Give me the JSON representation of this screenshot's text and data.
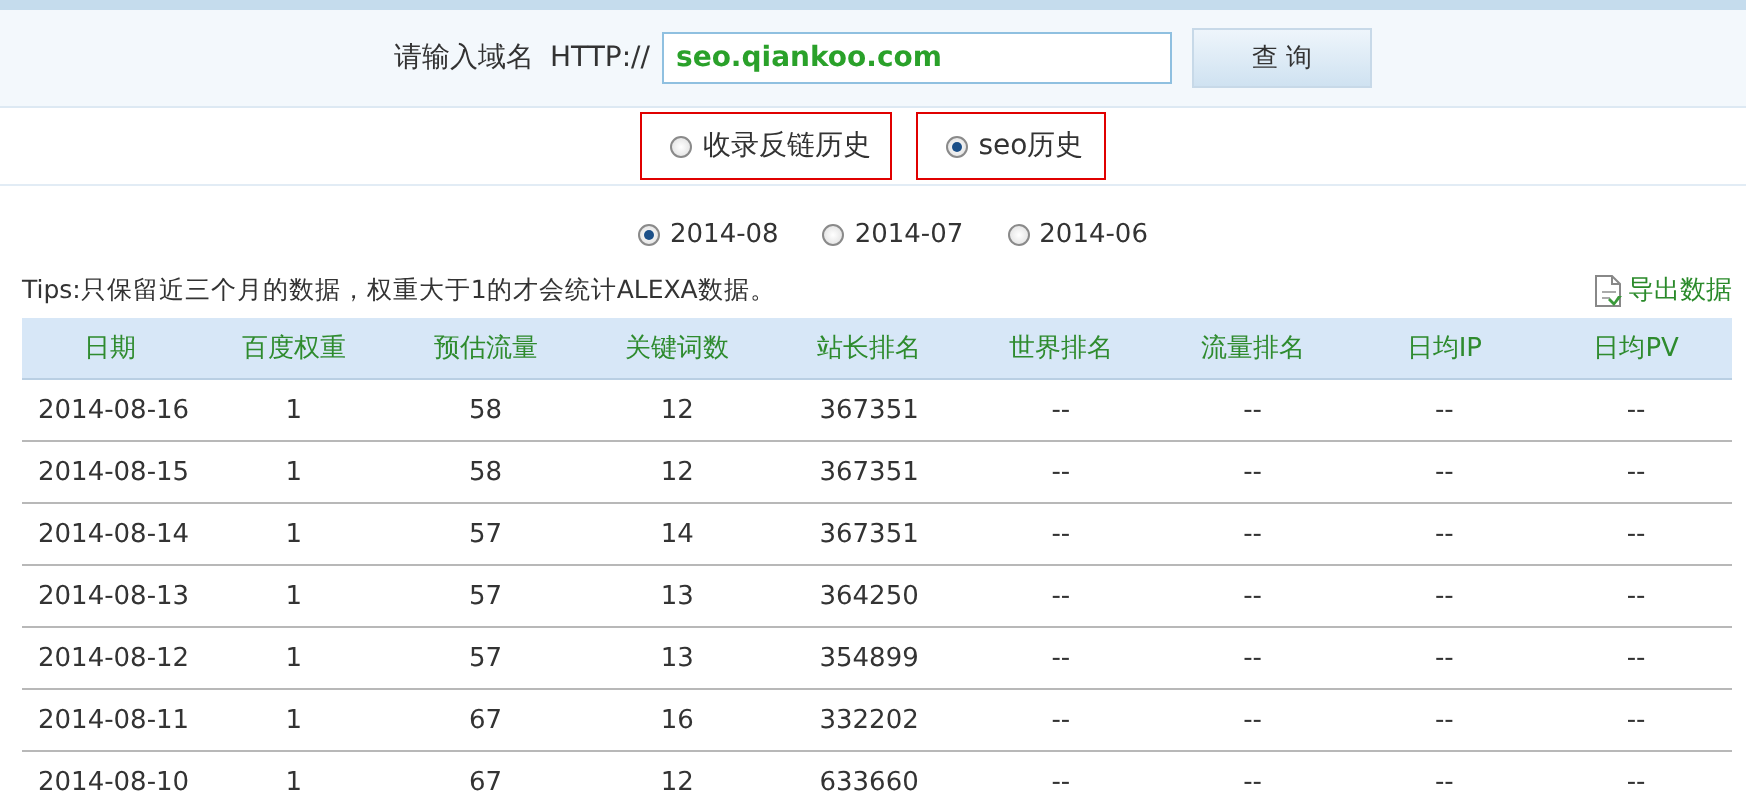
{
  "search": {
    "label": "请输入域名",
    "prefix": "HTTP://",
    "value": "seo.qiankoo.com",
    "button": "查 询"
  },
  "modes": [
    {
      "label": "收录反链历史",
      "selected": false
    },
    {
      "label": "seo历史",
      "selected": true
    }
  ],
  "periods": [
    {
      "label": "2014-08",
      "selected": true
    },
    {
      "label": "2014-07",
      "selected": false
    },
    {
      "label": "2014-06",
      "selected": false
    }
  ],
  "tips": "Tips:只保留近三个月的数据，权重大于1的才会统计ALEXA数据。",
  "export": "导出数据",
  "table": {
    "columns": [
      "日期",
      "百度权重",
      "预估流量",
      "关键词数",
      "站长排名",
      "世界排名",
      "流量排名",
      "日均IP",
      "日均PV"
    ],
    "rows": [
      [
        "2014-08-16",
        "1",
        "58",
        "12",
        "367351",
        "--",
        "--",
        "--",
        "--"
      ],
      [
        "2014-08-15",
        "1",
        "58",
        "12",
        "367351",
        "--",
        "--",
        "--",
        "--"
      ],
      [
        "2014-08-14",
        "1",
        "57",
        "14",
        "367351",
        "--",
        "--",
        "--",
        "--"
      ],
      [
        "2014-08-13",
        "1",
        "57",
        "13",
        "364250",
        "--",
        "--",
        "--",
        "--"
      ],
      [
        "2014-08-12",
        "1",
        "57",
        "13",
        "354899",
        "--",
        "--",
        "--",
        "--"
      ],
      [
        "2014-08-11",
        "1",
        "67",
        "16",
        "332202",
        "--",
        "--",
        "--",
        "--"
      ],
      [
        "2014-08-10",
        "1",
        "67",
        "12",
        "633660",
        "--",
        "--",
        "--",
        "--"
      ]
    ]
  }
}
